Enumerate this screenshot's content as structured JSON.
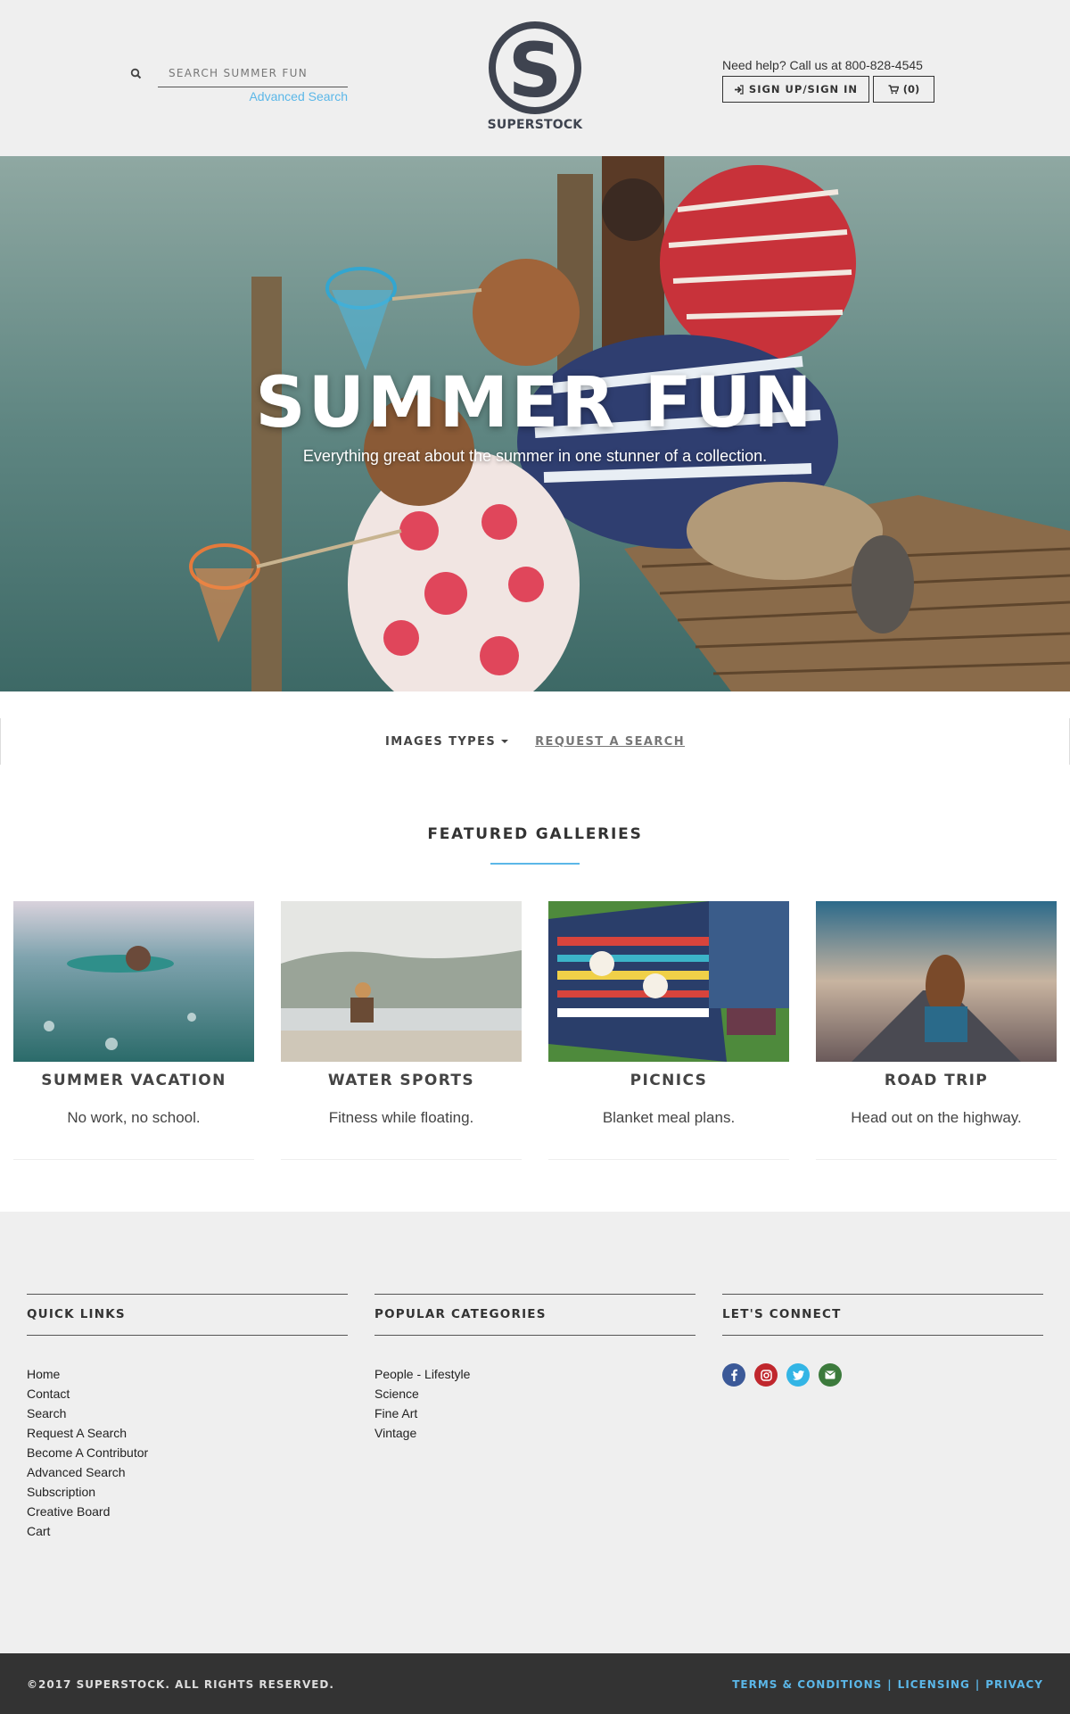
{
  "header": {
    "search_placeholder": "SEARCH SUMMER FUN",
    "advanced_search": "Advanced Search",
    "logo_text": "SUPERSTOCK",
    "help_text": "Need help? Call us at 800-828-4545",
    "sign_label": "SIGN UP/SIGN IN",
    "cart_label": "(0)"
  },
  "hero": {
    "title": "SUMMER FUN",
    "subtitle": "Everything great about the summer in one stunner of a collection."
  },
  "subnav": {
    "image_types": "IMAGES TYPES",
    "request_search": "REQUEST A SEARCH"
  },
  "featured": {
    "title": "FEATURED GALLERIES",
    "galleries": [
      {
        "name": "SUMMER VACATION",
        "desc": "No work, no school."
      },
      {
        "name": "WATER SPORTS",
        "desc": "Fitness while floating."
      },
      {
        "name": "PICNICS",
        "desc": "Blanket meal plans."
      },
      {
        "name": "ROAD TRIP",
        "desc": "Head out on the highway."
      }
    ]
  },
  "footer": {
    "quick_links_title": "QUICK LINKS",
    "quick_links": [
      "Home",
      "Contact",
      "Search",
      "Request A Search",
      "Become A Contributor",
      "Advanced Search",
      "Subscription",
      "Creative Board",
      "Cart"
    ],
    "popular_title": "POPULAR CATEGORIES",
    "popular": [
      "People - Lifestyle",
      "Science",
      "Fine Art",
      "Vintage"
    ],
    "connect_title": "LET'S CONNECT",
    "copyright": "©2017 SUPERSTOCK. ALL RIGHTS RESERVED.",
    "terms": "TERMS & CONDITIONS",
    "licensing": "LICENSING",
    "privacy": "PRIVACY",
    "separator": "|"
  },
  "colors": {
    "accent": "#5bb7e8",
    "header_bg": "#efefef",
    "footer_bottom": "#333333",
    "logo": "#3f4450",
    "facebook": "#3b5998",
    "instagram": "#c0272d",
    "twitter": "#33b5e5",
    "email": "#3c7a3c"
  }
}
